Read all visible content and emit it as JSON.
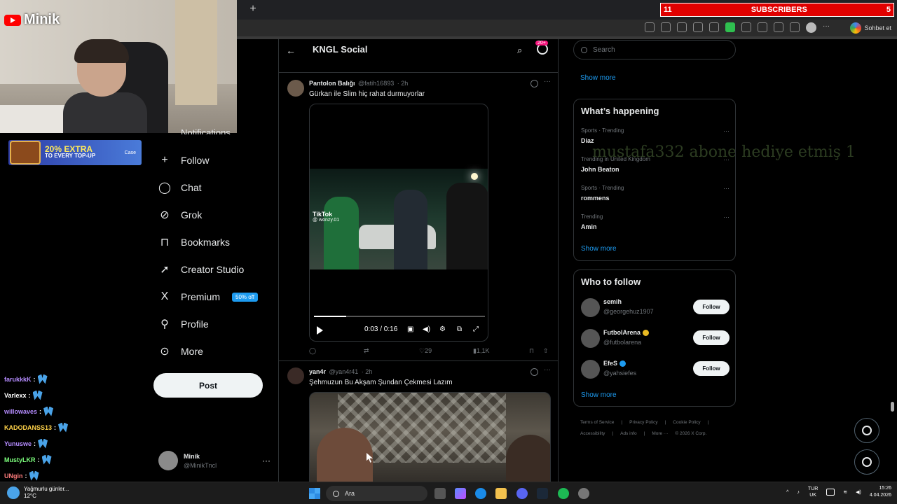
{
  "overlay": {
    "channel_name": "Minik",
    "promo": {
      "headline": "20% EXTRA",
      "subline": "TO EVERY TOP-UP",
      "brand": "Case"
    },
    "subscribers": {
      "current": "11",
      "label": "SUBSCRIBERS",
      "goal": "5"
    },
    "donation_text": "mustafa332 abone hediye etmiş 1",
    "chat": [
      {
        "user": "farukkkK",
        "color": "#b58cff"
      },
      {
        "user": "Varlexx",
        "color": "#ffffff"
      },
      {
        "user": "willowaves",
        "color": "#b58cff"
      },
      {
        "user": "KADODANSS13",
        "color": "#ffd24a"
      },
      {
        "user": "Yunuswe",
        "color": "#b58cff"
      },
      {
        "user": "MustyLKR",
        "color": "#7dff7d"
      },
      {
        "user": "UNgin",
        "color": "#ff7d7d"
      }
    ]
  },
  "browser": {
    "new_tab": "+",
    "profile_label": "Sohbet et"
  },
  "nav": {
    "partial_item": "Notifications",
    "items": [
      {
        "label": "Follow",
        "icon": "person-plus-icon"
      },
      {
        "label": "Chat",
        "icon": "chat-bubble-icon"
      },
      {
        "label": "Grok",
        "icon": "grok-icon"
      },
      {
        "label": "Bookmarks",
        "icon": "bookmark-icon"
      },
      {
        "label": "Creator Studio",
        "icon": "rocket-icon"
      },
      {
        "label": "Premium",
        "icon": "x-logo-icon"
      },
      {
        "label": "Profile",
        "icon": "person-icon"
      },
      {
        "label": "More",
        "icon": "more-circle-icon"
      }
    ],
    "premium_badge": "50% off",
    "post_button": "Post",
    "account": {
      "display_name": "Minik",
      "handle": "@MinikTncl",
      "menu": "···"
    }
  },
  "timeline": {
    "title": "KNGL Social",
    "notification_badge": "20+",
    "tweets": [
      {
        "author": "Pantolon Balığı",
        "handle": "@fatih16893",
        "time": "· 2h",
        "text": "Gürkan ile Slim hiç rahat durmuyorlar",
        "video": {
          "watermark": "TikTok",
          "watermark_handle": "@ wonzy.01",
          "time_display": "0:03 / 0:16",
          "progress": 0.19
        },
        "likes": "29",
        "views": "1,1K"
      },
      {
        "author": "yan4r",
        "handle": "@yan4r41",
        "time": "· 2h",
        "text": "Şehmuzun Bu Akşam Şundan Çekmesi Lazım"
      }
    ]
  },
  "right": {
    "search_placeholder": "Search",
    "top_show_more": "Show more",
    "happening": {
      "title": "What’s happening",
      "trends": [
        {
          "meta": "Sports · Trending",
          "name": "Diaz"
        },
        {
          "meta": "Trending in United Kingdom",
          "name": "John Beaton"
        },
        {
          "meta": "Sports · Trending",
          "name": "rommens"
        },
        {
          "meta": "Trending",
          "name": "Amin"
        }
      ],
      "show_more": "Show more"
    },
    "who_to_follow": {
      "title": "Who to follow",
      "accounts": [
        {
          "name": "semih",
          "handle": "@georgehuz1907",
          "verified": "",
          "button": "Follow"
        },
        {
          "name": "FutbolArena",
          "handle": "@futbolarena",
          "verified": "#e8b923",
          "button": "Follow"
        },
        {
          "name": "EfeS",
          "handle": "@yahsiefes",
          "verified": "#1d9bf0",
          "button": "Follow"
        }
      ],
      "show_more": "Show more"
    },
    "footer": {
      "line1": [
        "Terms of Service",
        "|",
        "Privacy Policy",
        "|",
        "Cookie Policy",
        "|"
      ],
      "line2": [
        "Accessibility",
        "|",
        "Ads info",
        "|",
        "More ···",
        "© 2026 X Corp."
      ]
    }
  },
  "taskbar": {
    "weather_title": "Yağmurlu günler...",
    "weather_temp": "12°C",
    "search_label": "Ara",
    "lang_top": "TUR",
    "lang_bottom": "UK",
    "time": "15:26",
    "date": "4.04.2026"
  }
}
